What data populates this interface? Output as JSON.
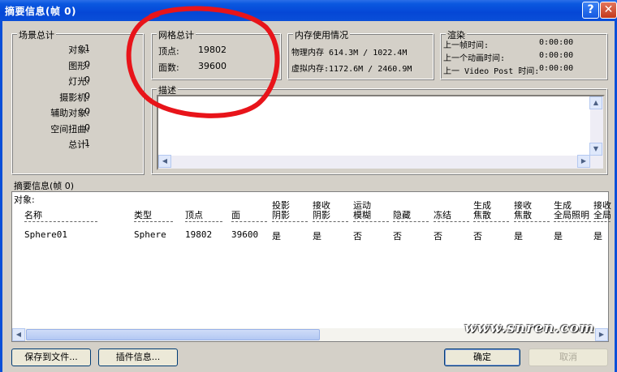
{
  "window": {
    "title": "摘要信息(帧 0)",
    "help_label": "?",
    "close_label": "✕"
  },
  "scene": {
    "legend": "场景总计",
    "items": [
      {
        "label": "对象:",
        "value": "1"
      },
      {
        "label": "图形:",
        "value": "0"
      },
      {
        "label": "灯光:",
        "value": "0"
      },
      {
        "label": "摄影机:",
        "value": "0"
      },
      {
        "label": "辅助对象:",
        "value": "0"
      },
      {
        "label": "空间扭曲:",
        "value": "0"
      },
      {
        "label": "总计:",
        "value": "1"
      }
    ]
  },
  "mesh": {
    "legend": "网格总计",
    "vertices_label": "顶点:",
    "vertices": "19802",
    "faces_label": "面数:",
    "faces": "39600"
  },
  "memory": {
    "legend": "内存使用情况",
    "physical": "物理内存 614.3M / 1022.4M",
    "virtual": "虚拟内存:1172.6M / 2460.9M"
  },
  "render": {
    "legend": "渲染",
    "rows": [
      {
        "label": "上一帧时间:",
        "value": "0:00:00"
      },
      {
        "label": "上一个动画时间:",
        "value": "0:00:00"
      },
      {
        "label": "上一 Video Post 时间:",
        "value": "0:00:00"
      }
    ]
  },
  "description": {
    "legend": "描述",
    "text": ""
  },
  "summary": {
    "label": "摘要信息(帧 0)",
    "objects_label": "对象:",
    "columns": [
      "名称",
      "类型",
      "顶点",
      "面",
      "投影\n阴影",
      "接收\n阴影",
      "运动\n模糊",
      "隐藏",
      "冻结",
      "生成\n焦散",
      "接收\n焦散",
      "生成\n全局照明",
      "接收\n全局"
    ],
    "rows": [
      [
        "Sphere01",
        "Sphere",
        "19802",
        "39600",
        "是",
        "是",
        "否",
        "否",
        "否",
        "否",
        "是",
        "是",
        "是"
      ]
    ]
  },
  "buttons": {
    "save": "保存到文件...",
    "plugin": "插件信息...",
    "ok": "确定",
    "cancel": "取消"
  },
  "watermark": "www.snren.com",
  "colors": {
    "titlebar": "#0a4fd8",
    "annotation": "#e8141a",
    "dialog": "#d4d0c8"
  }
}
